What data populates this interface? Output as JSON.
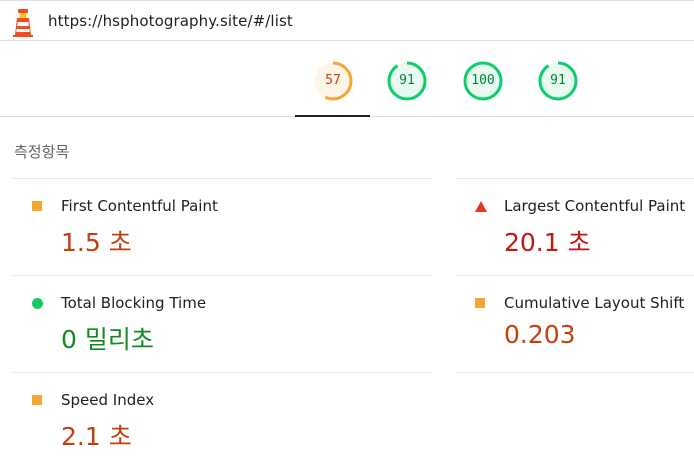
{
  "address_bar": {
    "icon": "lighthouse-icon",
    "url": "https://hsphotography.site/#/list"
  },
  "gauges": [
    {
      "score": "57",
      "fraction": 0.57,
      "color": "#f4a633",
      "fill": "#fff5e6",
      "text_color": "#c4400f",
      "selected": true
    },
    {
      "score": "91",
      "fraction": 0.91,
      "color": "#0cce6b",
      "fill": "#e8f9ef",
      "text_color": "#008a3a",
      "selected": false
    },
    {
      "score": "100",
      "fraction": 1.0,
      "color": "#0cce6b",
      "fill": "#e8f9ef",
      "text_color": "#008a3a",
      "selected": false
    },
    {
      "score": "91",
      "fraction": 0.91,
      "color": "#0cce6b",
      "fill": "#e8f9ef",
      "text_color": "#008a3a",
      "selected": false
    }
  ],
  "metrics_section": {
    "title": "측정항목",
    "items": [
      {
        "title": "First Contentful Paint",
        "value": "1.5 초",
        "rating": "average",
        "indicator": "orange-square-icon"
      },
      {
        "title": "Largest Contentful Paint",
        "value": "20.1 초",
        "rating": "fail",
        "indicator": "red-triangle-icon"
      },
      {
        "title": "Total Blocking Time",
        "value": "0 밀리초",
        "rating": "pass",
        "indicator": "green-circle-icon"
      },
      {
        "title": "Cumulative Layout Shift",
        "value": "0.203",
        "rating": "average",
        "indicator": "orange-square-icon"
      },
      {
        "title": "Speed Index",
        "value": "2.1 초",
        "rating": "average",
        "indicator": "orange-square-icon"
      }
    ]
  },
  "colors": {
    "average": "#f4a633",
    "fail": "#e5352b",
    "pass": "#18c964"
  }
}
